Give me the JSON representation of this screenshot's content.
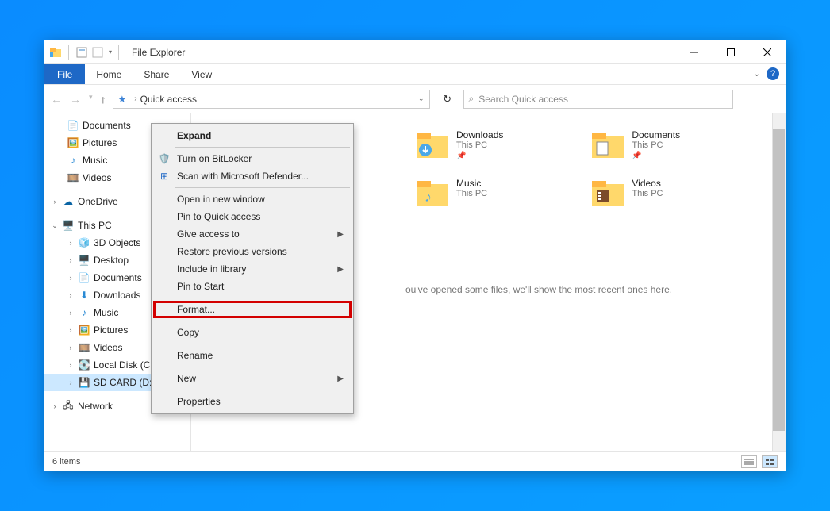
{
  "window": {
    "title": "File Explorer",
    "tabs": {
      "file": "File",
      "home": "Home",
      "share": "Share",
      "view": "View"
    }
  },
  "breadcrumb": {
    "root": "Quick access"
  },
  "search": {
    "placeholder": "Search Quick access"
  },
  "sidebar": {
    "quickaccess": {
      "documents": "Documents",
      "pictures": "Pictures",
      "music": "Music",
      "videos": "Videos"
    },
    "onedrive": "OneDrive",
    "thispc": {
      "label": "This PC",
      "items": {
        "objects3d": "3D Objects",
        "desktop": "Desktop",
        "documents": "Documents",
        "downloads": "Downloads",
        "music": "Music",
        "pictures": "Pictures",
        "videos": "Videos",
        "localdisk": "Local Disk (C:",
        "sdcard": "SD CARD (D:)"
      }
    },
    "network": "Network"
  },
  "folders": {
    "downloads": {
      "name": "Downloads",
      "loc": "This PC"
    },
    "documents": {
      "name": "Documents",
      "loc": "This PC"
    },
    "music": {
      "name": "Music",
      "loc": "This PC"
    },
    "videos": {
      "name": "Videos",
      "loc": "This PC"
    }
  },
  "empty_hint": "ou've opened some files, we'll show the most recent ones here.",
  "status": {
    "items": "6 items"
  },
  "context_menu": {
    "expand": "Expand",
    "bitlocker": "Turn on BitLocker",
    "defender": "Scan with Microsoft Defender...",
    "open_new": "Open in new window",
    "pin_qa": "Pin to Quick access",
    "give_access": "Give access to",
    "restore": "Restore previous versions",
    "include_lib": "Include in library",
    "pin_start": "Pin to Start",
    "format": "Format...",
    "copy": "Copy",
    "rename": "Rename",
    "new": "New",
    "properties": "Properties"
  }
}
